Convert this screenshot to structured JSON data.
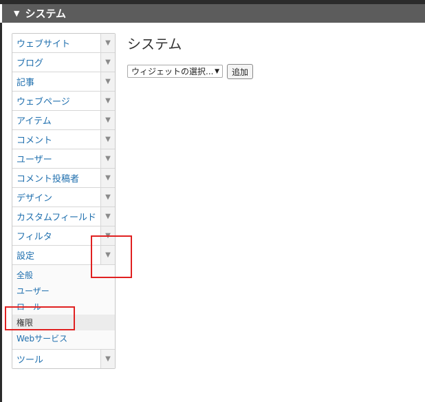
{
  "header": {
    "toggle_icon": "triangle-down-icon",
    "title": "システム"
  },
  "menu": {
    "items_before": [
      {
        "label": "ウェブサイト"
      },
      {
        "label": "ブログ"
      },
      {
        "label": "記事"
      },
      {
        "label": "ウェブページ"
      },
      {
        "label": "アイテム"
      },
      {
        "label": "コメント"
      },
      {
        "label": "ユーザー"
      },
      {
        "label": "コメント投稿者"
      },
      {
        "label": "デザイン"
      },
      {
        "label": "カスタムフィールド"
      },
      {
        "label": "フィルタ"
      },
      {
        "label": "設定"
      }
    ],
    "expanded_item": "設定",
    "submenu": [
      {
        "label": "全般"
      },
      {
        "label": "ユーザー"
      },
      {
        "label": "ロール"
      },
      {
        "label": "権限",
        "active": true
      },
      {
        "label": "Webサービス"
      }
    ],
    "items_after": [
      {
        "label": "ツール"
      }
    ],
    "arrow_icon": "triangle-down-icon"
  },
  "main": {
    "title": "システム",
    "widget_select": {
      "selected": "ウィジェットの選択...",
      "caret": "▼"
    },
    "add_button": "追加"
  },
  "colors": {
    "link": "#1f6fae",
    "header_bg": "#5c5c5c",
    "highlight_box": "#e02020"
  }
}
